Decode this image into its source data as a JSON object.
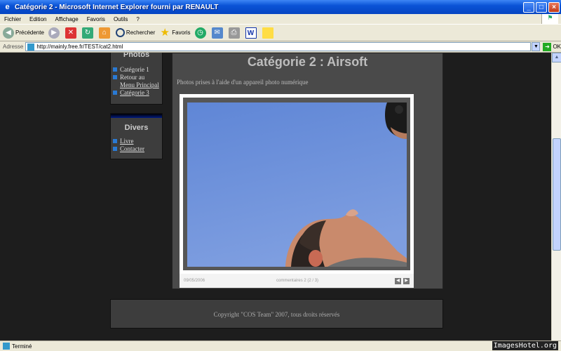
{
  "window": {
    "title": "Catégorie 2 - Microsoft Internet Explorer fourni par RENAULT",
    "buttons": {
      "minimize": "_",
      "maximize": "□",
      "close": "×"
    }
  },
  "menu": [
    "Fichier",
    "Edition",
    "Affichage",
    "Favoris",
    "Outils",
    "?"
  ],
  "toolbar": {
    "back_label": "Précédente",
    "search_label": "Rechercher",
    "favorites_label": "Favoris"
  },
  "address": {
    "label": "Adresse",
    "url": "http://mainly.free.fr/TEST/cat2.html",
    "go_label": "OK"
  },
  "sidebar_photos": {
    "heading": "Photos",
    "items": [
      "Catégorie 1",
      "Retour au",
      "Menu Principal",
      "Catégorie 3"
    ]
  },
  "sidebar_divers": {
    "heading": "Divers",
    "items": [
      "Livre",
      "Contacter"
    ]
  },
  "main": {
    "title": "Catégorie 2 : Airsoft",
    "subtitle": "Photos prises à l'aide d'un appareil photo numérique",
    "caption_left": "09/05/2006",
    "caption_mid": "commentaires 2 (2 / 3)"
  },
  "footer": {
    "text": "Copyright \"COS Team\" 2007, tous droits réservés"
  },
  "status": {
    "text": "Terminé",
    "watermark": "ImagesHotel.org"
  }
}
